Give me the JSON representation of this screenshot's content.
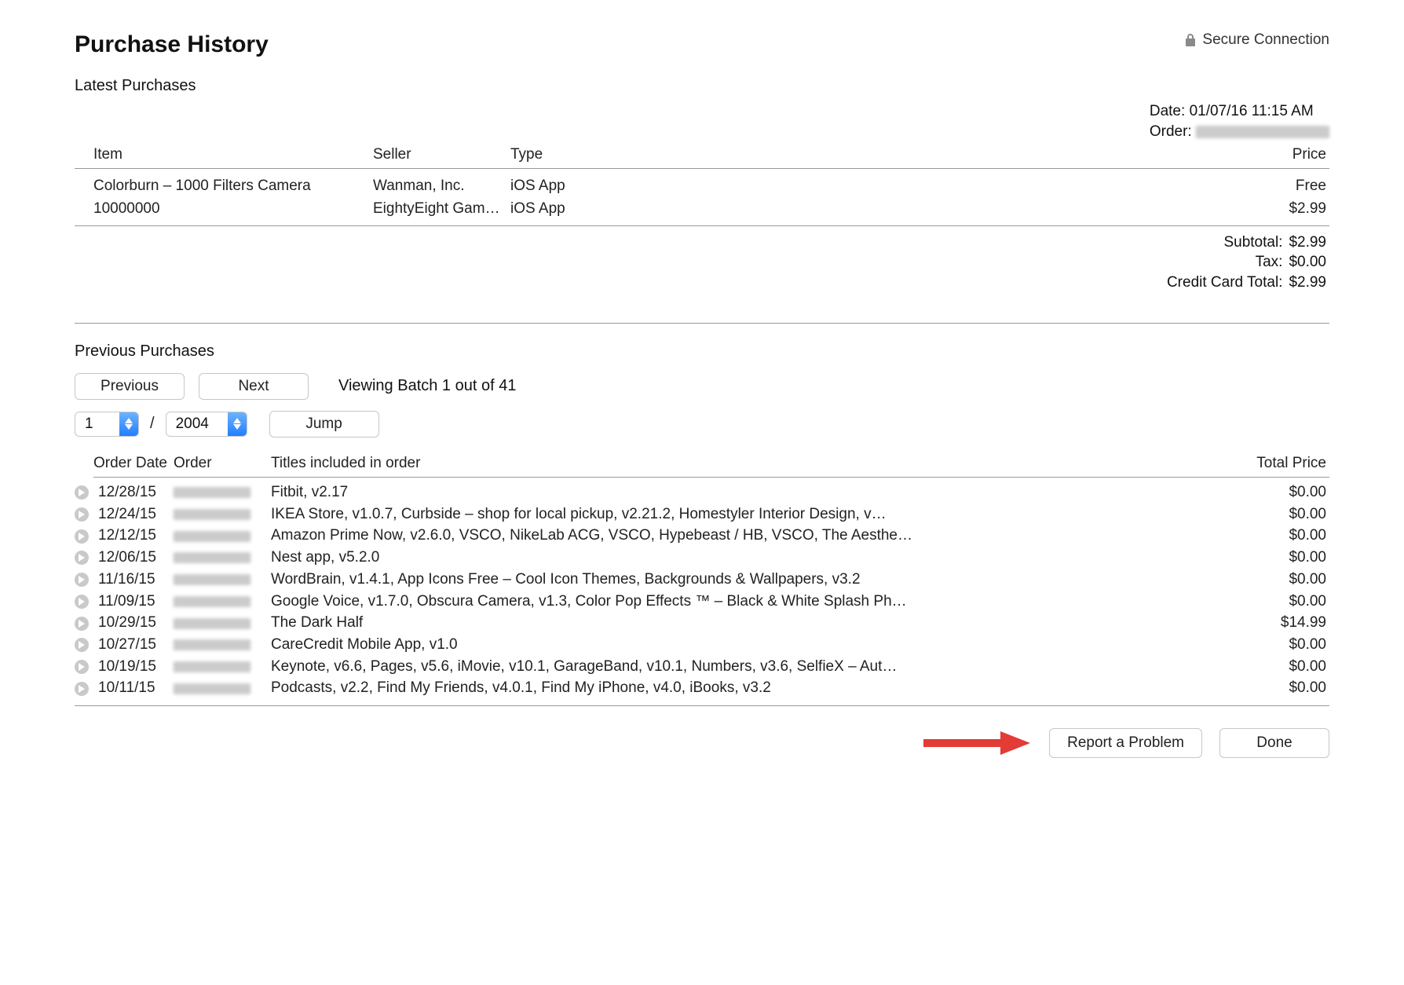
{
  "header": {
    "title": "Purchase History",
    "secure_label": "Secure Connection"
  },
  "latest": {
    "heading": "Latest Purchases",
    "meta": {
      "date_label": "Date:",
      "date_value": "01/07/16 11:15 AM",
      "order_label": "Order:"
    },
    "columns": {
      "item": "Item",
      "seller": "Seller",
      "type": "Type",
      "price": "Price"
    },
    "rows": [
      {
        "item": "Colorburn – 1000 Filters Camera",
        "seller": "Wanman, Inc.",
        "type": "iOS App",
        "price": "Free"
      },
      {
        "item": "10000000",
        "seller": "EightyEight Gam…",
        "type": "iOS App",
        "price": "$2.99"
      }
    ],
    "totals": {
      "subtotal_label": "Subtotal:",
      "subtotal_value": "$2.99",
      "tax_label": "Tax:",
      "tax_value": "$0.00",
      "cc_label": "Credit Card Total:",
      "cc_value": "$2.99"
    }
  },
  "previous": {
    "heading": "Previous Purchases",
    "buttons": {
      "previous": "Previous",
      "next": "Next",
      "jump": "Jump"
    },
    "viewing": "Viewing Batch 1 out of 41",
    "month_value": "1",
    "year_value": "2004",
    "columns": {
      "date": "Order Date",
      "order": "Order",
      "titles": "Titles included in order",
      "total": "Total Price"
    },
    "orders": [
      {
        "date": "12/28/15",
        "titles": "Fitbit, v2.17",
        "total": "$0.00"
      },
      {
        "date": "12/24/15",
        "titles": "IKEA Store, v1.0.7, Curbside – shop for local pickup, v2.21.2, Homestyler Interior Design, v…",
        "total": "$0.00"
      },
      {
        "date": "12/12/15",
        "titles": "Amazon Prime Now, v2.6.0, VSCO, NikeLab ACG, VSCO, Hypebeast / HB, VSCO, The Aesthe…",
        "total": "$0.00"
      },
      {
        "date": "12/06/15",
        "titles": "Nest app, v5.2.0",
        "total": "$0.00"
      },
      {
        "date": "11/16/15",
        "titles": "WordBrain, v1.4.1, App Icons Free – Cool Icon Themes, Backgrounds & Wallpapers, v3.2",
        "total": "$0.00"
      },
      {
        "date": "11/09/15",
        "titles": "Google Voice, v1.7.0, Obscura Camera, v1.3, Color Pop Effects ™ – Black & White Splash Ph…",
        "total": "$0.00"
      },
      {
        "date": "10/29/15",
        "titles": "The Dark Half",
        "total": "$14.99"
      },
      {
        "date": "10/27/15",
        "titles": "CareCredit Mobile App, v1.0",
        "total": "$0.00"
      },
      {
        "date": "10/19/15",
        "titles": "Keynote, v6.6, Pages, v5.6, iMovie, v10.1, GarageBand, v10.1, Numbers, v3.6, SelfieX – Aut…",
        "total": "$0.00"
      },
      {
        "date": "10/11/15",
        "titles": "Podcasts, v2.2, Find My Friends, v4.0.1, Find My iPhone, v4.0, iBooks, v3.2",
        "total": "$0.00"
      }
    ]
  },
  "footer": {
    "report": "Report a Problem",
    "done": "Done"
  }
}
